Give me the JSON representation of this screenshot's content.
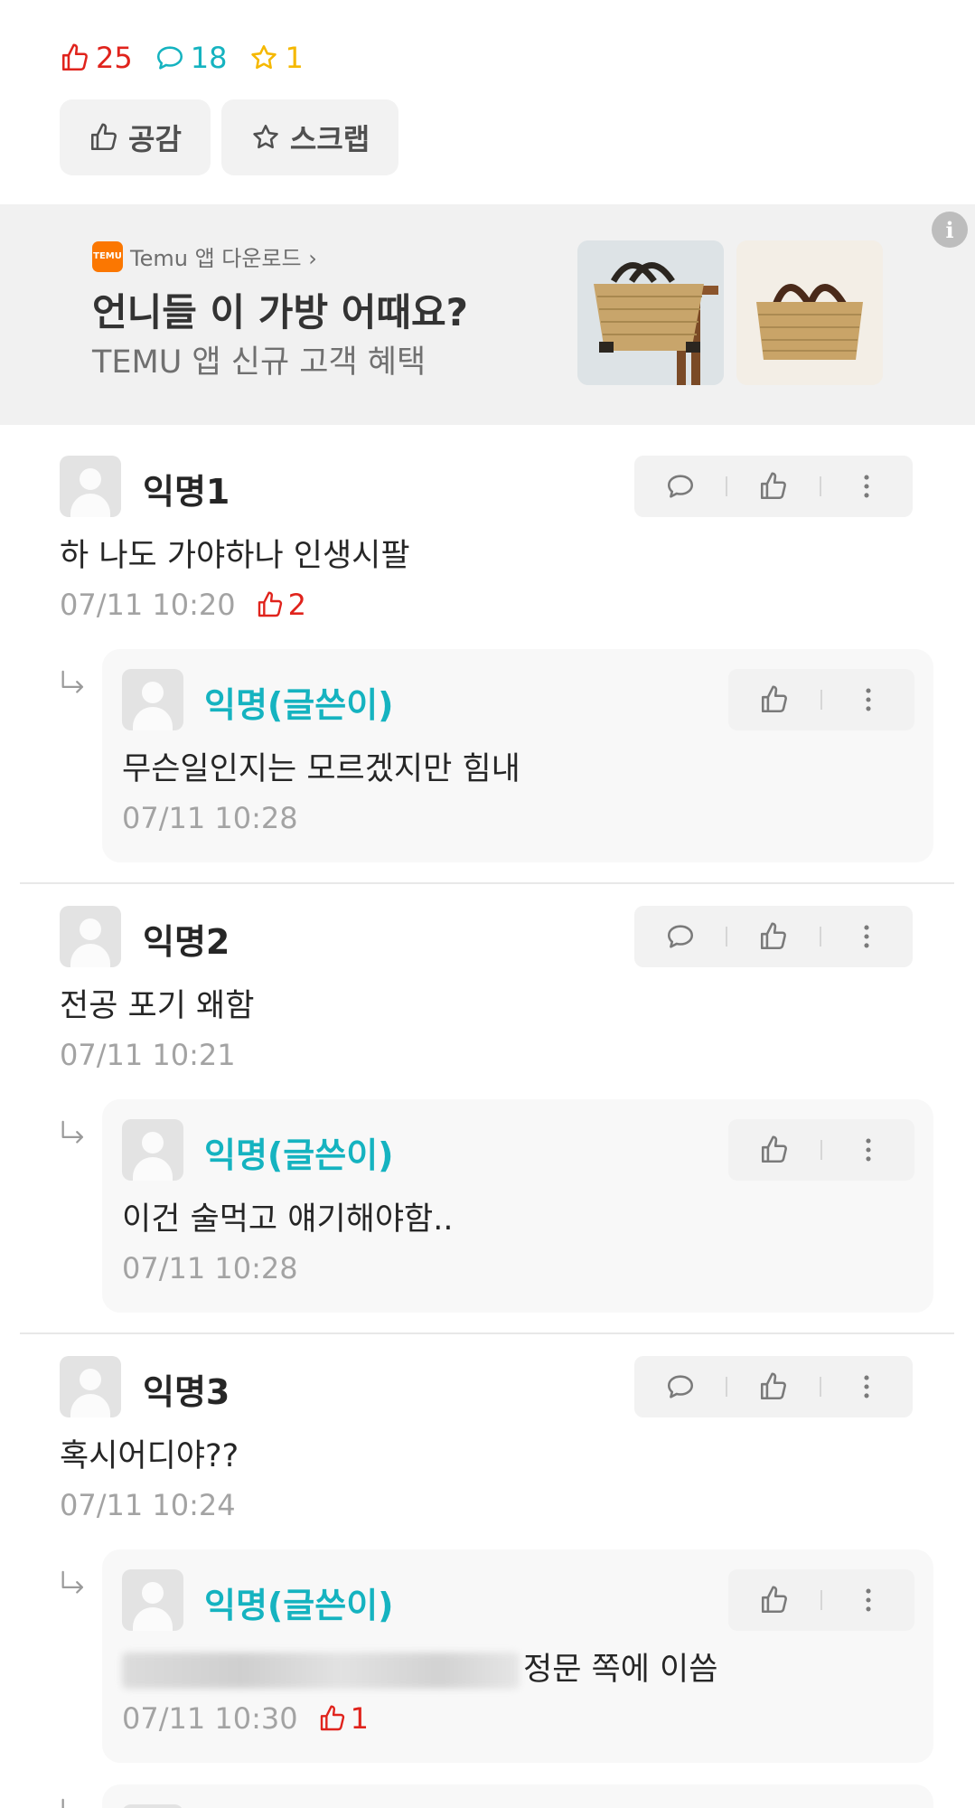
{
  "post_stats": {
    "likes": "25",
    "comments": "18",
    "scraps": "1",
    "like_color": "#e0231c",
    "comment_color": "#15b3c0",
    "scrap_color": "#f5b800"
  },
  "actions": {
    "like_label": "공감",
    "scrap_label": "스크랩"
  },
  "ad": {
    "source": "Temu 앱 다운로드 ›",
    "logo_text": "TEMU",
    "title": "언니들 이 가방 어때요?",
    "subtitle": "TEMU 앱 신규 고객 혜택",
    "info_icon": "info-icon",
    "brand_color": "#fb7701"
  },
  "comments": [
    {
      "nickname": "익명1",
      "text": "하 나도 가야하나 인생시팔",
      "time": "07/11 10:20",
      "likes": "2",
      "reply": {
        "nickname": "익명(글쓴이)",
        "text": "무슨일인지는 모르겠지만 힘내",
        "time": "07/11 10:28"
      }
    },
    {
      "nickname": "익명2",
      "text": "전공 포기 왜함",
      "time": "07/11 10:21",
      "reply": {
        "nickname": "익명(글쓴이)",
        "text": "이건 술먹고 얘기해야함..",
        "time": "07/11 10:28"
      }
    },
    {
      "nickname": "익명3",
      "text": "혹시어디야??",
      "time": "07/11 10:24",
      "reply": {
        "nickname": "익명(글쓴이)",
        "text": "정문 쪽에 이씀",
        "time": "07/11 10:30",
        "likes": "1"
      }
    }
  ]
}
